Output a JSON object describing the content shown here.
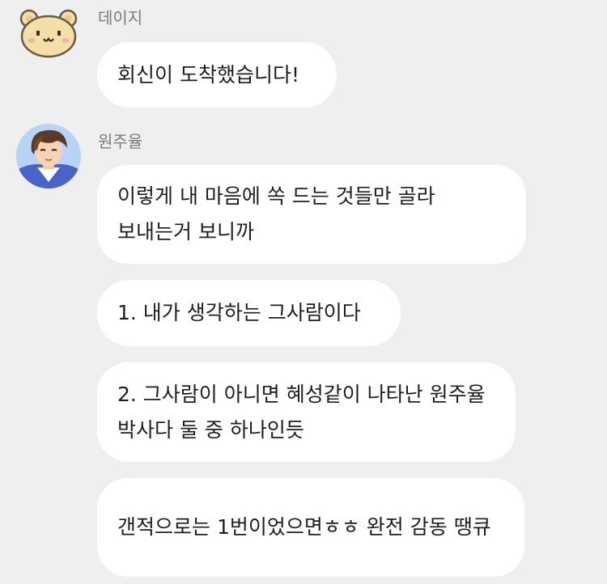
{
  "messages": [
    {
      "sender": "데이지",
      "avatar": "bear-avatar-icon",
      "bubbles": [
        "회신이 도착했습니다!"
      ]
    },
    {
      "sender": "원주율",
      "avatar": "profile-avatar-icon",
      "bubbles": [
        "이렇게 내 마음에 쏙 드는 것들만 골라 보내는거 보니까",
        "1. 내가 생각하는 그사람이다",
        "2. 그사람이 아니면 혜성같이 나타난 원주율 박사다 둘 중 하나인듯",
        "갠적으로는 1번이었으면ㅎㅎ 완전 감동 땡큐"
      ]
    }
  ],
  "colors": {
    "background": "#efefef",
    "bubble": "#ffffff",
    "text": "#1e1e1e",
    "sender": "#7a7a7a",
    "bear_fur": "#f3dfa8",
    "avatar_bg": "#b7d3f5"
  }
}
